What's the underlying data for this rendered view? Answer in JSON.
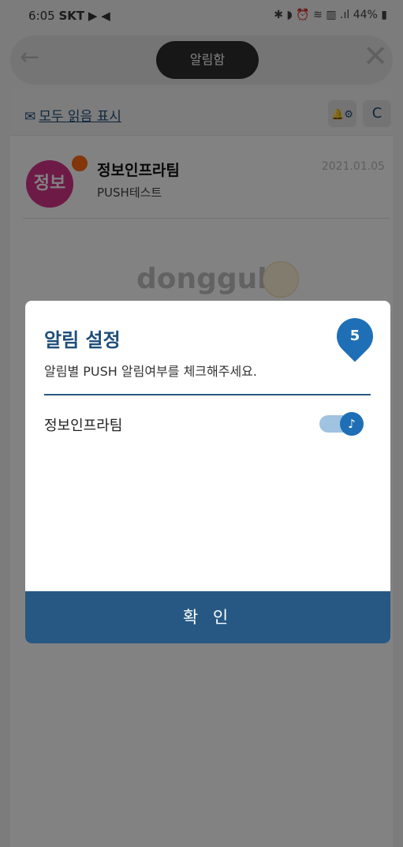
{
  "status_bar": {
    "time": "6:05",
    "carrier": "SKT",
    "icons": "▶ ◀",
    "right": "✱ ◗ ⏰ ≋ ▥ .ıl 44% ▮"
  },
  "navbar": {
    "title": "알림함",
    "back_icon": "←",
    "close_icon": "✕"
  },
  "toolbar": {
    "mark_all_read": "모두 읽음 표시",
    "settings_icon": "🔔⚙",
    "refresh_icon": "C"
  },
  "notifications": [
    {
      "avatar_text": "정보",
      "title": "정보인프라팀",
      "subtitle": "PUSH테스트",
      "date": "2021.01.05"
    }
  ],
  "logo_text": "dongguk",
  "modal": {
    "title": "알림 설정",
    "description": "알림별 PUSH 알림여부를 체크해주세요.",
    "badge": "5",
    "settings": [
      {
        "label": "정보인프라팀",
        "enabled": true
      }
    ],
    "confirm_label": "확 인"
  },
  "colors": {
    "primary": "#1f4e79",
    "toggle": "#1f6fb6",
    "avatar": "#d6338a",
    "unread_dot": "#ff6a13",
    "confirm_bg": "#265883"
  }
}
